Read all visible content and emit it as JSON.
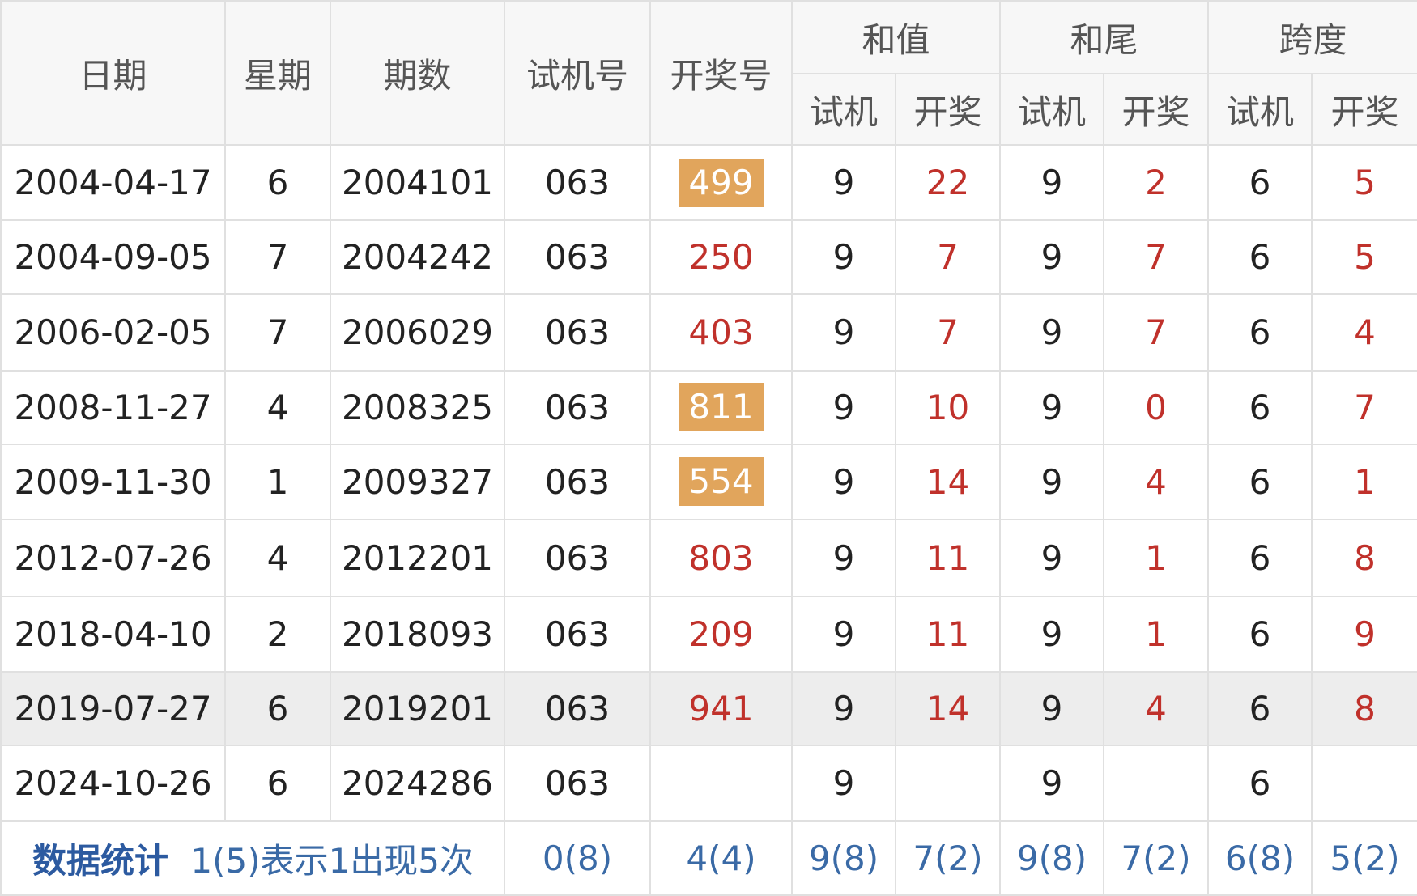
{
  "header": {
    "date": "日期",
    "weekday": "星期",
    "issue": "期数",
    "trial": "试机号",
    "draw": "开奖号",
    "sum": "和值",
    "sum_tail": "和尾",
    "span": "跨度",
    "sub_trial": "试机",
    "sub_draw": "开奖"
  },
  "rows": [
    {
      "date": "2004-04-17",
      "weekday": "6",
      "issue": "2004101",
      "trial": "063",
      "draw": "499",
      "highlight": true,
      "sum_t": "9",
      "sum_d": "22",
      "tail_t": "9",
      "tail_d": "2",
      "span_t": "6",
      "span_d": "5"
    },
    {
      "date": "2004-09-05",
      "weekday": "7",
      "issue": "2004242",
      "trial": "063",
      "draw": "250",
      "highlight": false,
      "sum_t": "9",
      "sum_d": "7",
      "tail_t": "9",
      "tail_d": "7",
      "span_t": "6",
      "span_d": "5"
    },
    {
      "date": "2006-02-05",
      "weekday": "7",
      "issue": "2006029",
      "trial": "063",
      "draw": "403",
      "highlight": false,
      "sum_t": "9",
      "sum_d": "7",
      "tail_t": "9",
      "tail_d": "7",
      "span_t": "6",
      "span_d": "4"
    },
    {
      "date": "2008-11-27",
      "weekday": "4",
      "issue": "2008325",
      "trial": "063",
      "draw": "811",
      "highlight": true,
      "sum_t": "9",
      "sum_d": "10",
      "tail_t": "9",
      "tail_d": "0",
      "span_t": "6",
      "span_d": "7"
    },
    {
      "date": "2009-11-30",
      "weekday": "1",
      "issue": "2009327",
      "trial": "063",
      "draw": "554",
      "highlight": true,
      "sum_t": "9",
      "sum_d": "14",
      "tail_t": "9",
      "tail_d": "4",
      "span_t": "6",
      "span_d": "1"
    },
    {
      "date": "2012-07-26",
      "weekday": "4",
      "issue": "2012201",
      "trial": "063",
      "draw": "803",
      "highlight": false,
      "sum_t": "9",
      "sum_d": "11",
      "tail_t": "9",
      "tail_d": "1",
      "span_t": "6",
      "span_d": "8"
    },
    {
      "date": "2018-04-10",
      "weekday": "2",
      "issue": "2018093",
      "trial": "063",
      "draw": "209",
      "highlight": false,
      "sum_t": "9",
      "sum_d": "11",
      "tail_t": "9",
      "tail_d": "1",
      "span_t": "6",
      "span_d": "9"
    },
    {
      "date": "2019-07-27",
      "weekday": "6",
      "issue": "2019201",
      "trial": "063",
      "draw": "941",
      "highlight": false,
      "sum_t": "9",
      "sum_d": "14",
      "tail_t": "9",
      "tail_d": "4",
      "span_t": "6",
      "span_d": "8"
    },
    {
      "date": "2024-10-26",
      "weekday": "6",
      "issue": "2024286",
      "trial": "063",
      "draw": "",
      "highlight": false,
      "sum_t": "9",
      "sum_d": "",
      "tail_t": "9",
      "tail_d": "",
      "span_t": "6",
      "span_d": ""
    }
  ],
  "stats": {
    "title": "数据统计",
    "note": "1(5)表示1出现5次",
    "trial": "0(8)",
    "draw": "4(4)",
    "sum_t": "9(8)",
    "sum_d": "7(2)",
    "tail_t": "9(8)",
    "tail_d": "7(2)",
    "span_t": "6(8)",
    "span_d": "5(2)"
  },
  "colors": {
    "highlight_bg": "#e1a55c",
    "draw_text": "#c0312b",
    "stat_text": "#3a6aa6"
  }
}
